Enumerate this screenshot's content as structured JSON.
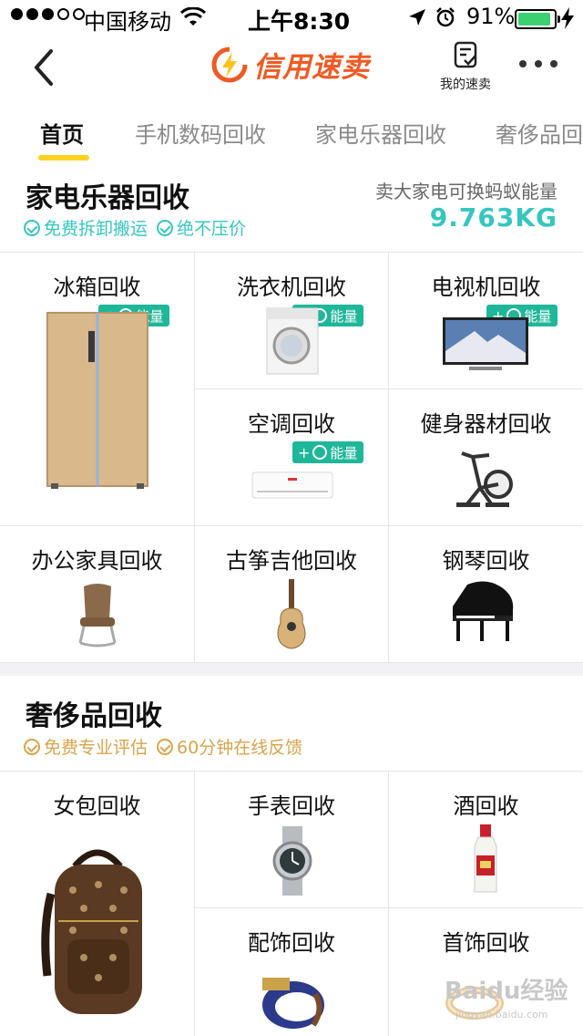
{
  "status_bar": {
    "carrier": "中国移动",
    "time": "上午8:30",
    "battery": "91%",
    "battery_level": 0.91,
    "icons": [
      "signal-dots-icon",
      "wifi-icon",
      "location-arrow-icon",
      "alarm-icon",
      "battery-icon",
      "charging-bolt-icon"
    ]
  },
  "nav": {
    "back_icon": "chevron-left-icon",
    "brand": "信用速卖",
    "brand_icon": "lightning-logo-icon",
    "brand_color": "#ef5a24",
    "my_label": "我的速卖",
    "my_icon": "clipboard-check-icon",
    "more_icon": "more-dots-icon"
  },
  "tabs": [
    {
      "label": "首页",
      "active": true
    },
    {
      "label": "手机数码回收",
      "active": false
    },
    {
      "label": "家电乐器回收",
      "active": false
    },
    {
      "label": "奢侈品回",
      "active": false
    }
  ],
  "accent_color": "#ffd21f",
  "appliances": {
    "title": "家电乐器回收",
    "perks": [
      "免费拆卸搬运",
      "绝不压价"
    ],
    "energy_label": "卖大家电可换蚂蚁能量",
    "energy_value": "9.763KG",
    "badge_label": "能量",
    "items": [
      {
        "label": "冰箱回收",
        "icon": "refrigerator-icon",
        "badge": true
      },
      {
        "label": "洗衣机回收",
        "icon": "washing-machine-icon",
        "badge": true
      },
      {
        "label": "电视机回收",
        "icon": "television-icon",
        "badge": true
      },
      {
        "label": "空调回收",
        "icon": "air-conditioner-icon",
        "badge": true
      },
      {
        "label": "健身器材回收",
        "icon": "exercise-bike-icon",
        "badge": false
      },
      {
        "label": "办公家具回收",
        "icon": "office-chair-icon",
        "badge": false
      },
      {
        "label": "古筝吉他回收",
        "icon": "guitar-icon",
        "badge": false
      },
      {
        "label": "钢琴回收",
        "icon": "grand-piano-icon",
        "badge": false
      }
    ]
  },
  "luxury": {
    "title": "奢侈品回收",
    "perks": [
      "免费专业评估",
      "60分钟在线反馈"
    ],
    "items": [
      {
        "label": "女包回收",
        "icon": "backpack-icon"
      },
      {
        "label": "手表回收",
        "icon": "watch-icon"
      },
      {
        "label": "酒回收",
        "icon": "liquor-bottle-icon"
      },
      {
        "label": "配饰回收",
        "icon": "bracelet-icon"
      },
      {
        "label": "首饰回收",
        "icon": "ring-icon"
      }
    ]
  },
  "watermark": "Baidu经验",
  "watermark_sub": "jingyan.baidu.com"
}
